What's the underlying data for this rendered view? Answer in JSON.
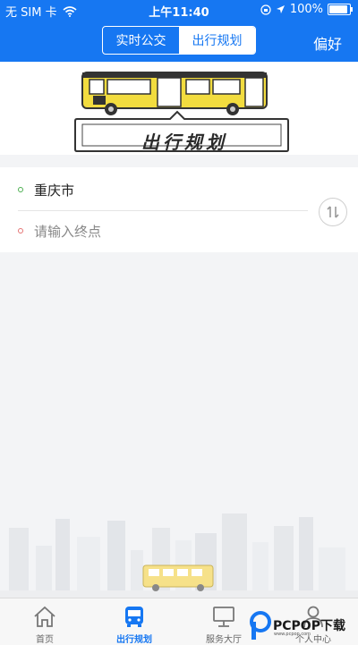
{
  "status_bar": {
    "carrier": "无 SIM 卡",
    "time": "上午11:40",
    "battery": "100%"
  },
  "header": {
    "tabs": [
      {
        "label": "实时公交"
      },
      {
        "label": "出行规划"
      }
    ],
    "active_tab": 1,
    "right_label": "偏好"
  },
  "banner": {
    "sign_text": "出行规划"
  },
  "trip": {
    "start": "重庆市",
    "end_placeholder": "请输入终点"
  },
  "tabbar": {
    "items": [
      {
        "label": "首页"
      },
      {
        "label": "出行规划"
      },
      {
        "label": "服务大厅"
      },
      {
        "label": "个人中心"
      }
    ],
    "active": 1
  },
  "watermark": {
    "text": "PCPOP下载",
    "sub": "www.pcpop.com"
  },
  "colors": {
    "primary": "#1677f2",
    "start_dot": "#4caf50",
    "end_dot": "#e57373",
    "bus_yellow": "#f2dc3f"
  }
}
